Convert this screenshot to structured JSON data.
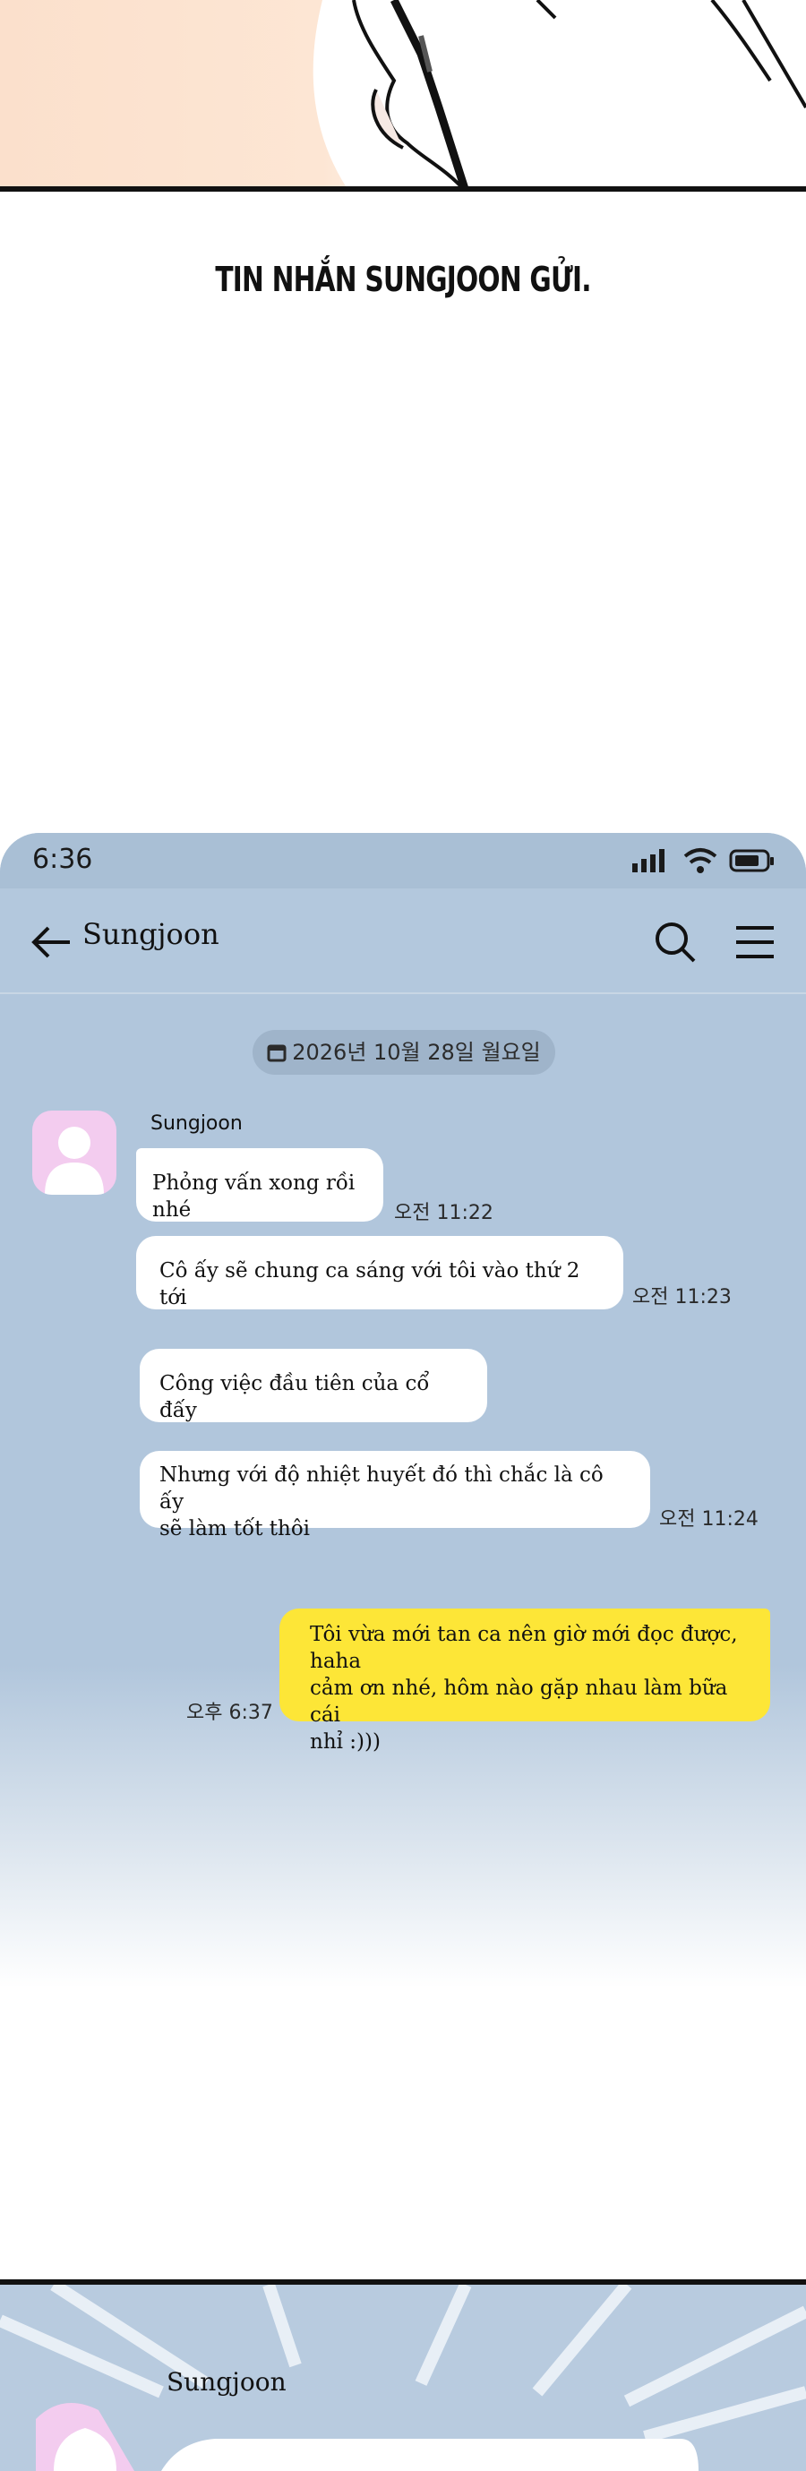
{
  "caption": "TIN NHẮN SUNGJOON GỬI.",
  "phone": {
    "status": {
      "time": "6:36",
      "icons": [
        "signal-icon",
        "wifi-icon",
        "battery-icon"
      ]
    },
    "header": {
      "back_icon": "arrow-left-icon",
      "contact_name": "Sungjoon",
      "search_icon": "search-icon",
      "menu_icon": "menu-icon"
    },
    "date_divider": {
      "icon": "calendar-icon",
      "text": "2026년 10월 28일 월요일"
    },
    "sender": {
      "name": "Sungjoon",
      "avatar_icon": "person-silhouette-icon"
    },
    "messages": [
      {
        "from": "Sungjoon",
        "lines": [
          "Phỏng vấn xong rồi nhé"
        ],
        "time": "오전 11:22"
      },
      {
        "from": "Sungjoon",
        "lines": [
          "Cô ấy sẽ chung ca sáng với tôi vào thứ 2 tới"
        ],
        "time": "오전 11:23"
      },
      {
        "from": "Sungjoon",
        "lines": [
          "Công việc đầu tiên của cổ đấy"
        ],
        "time": ""
      },
      {
        "from": "Sungjoon",
        "lines": [
          "Nhưng với độ nhiệt huyết đó thì chắc là cô ấy",
          "sẽ làm tốt thôi"
        ],
        "time": "오전 11:24"
      },
      {
        "from": "me",
        "lines": [
          "Tôi vừa mới tan ca nên giờ mới đọc được, haha",
          "cảm ơn nhé, hôm nào gặp nhau làm bữa cái",
          "nhỉ :)))"
        ],
        "time": "오후 6:37"
      }
    ],
    "colors": {
      "background": "#b1c6dc",
      "incoming_bubble": "#ffffff",
      "outgoing_bubble": "#fde637"
    }
  },
  "bottom_panel": {
    "sender_name": "Sungjoon"
  }
}
